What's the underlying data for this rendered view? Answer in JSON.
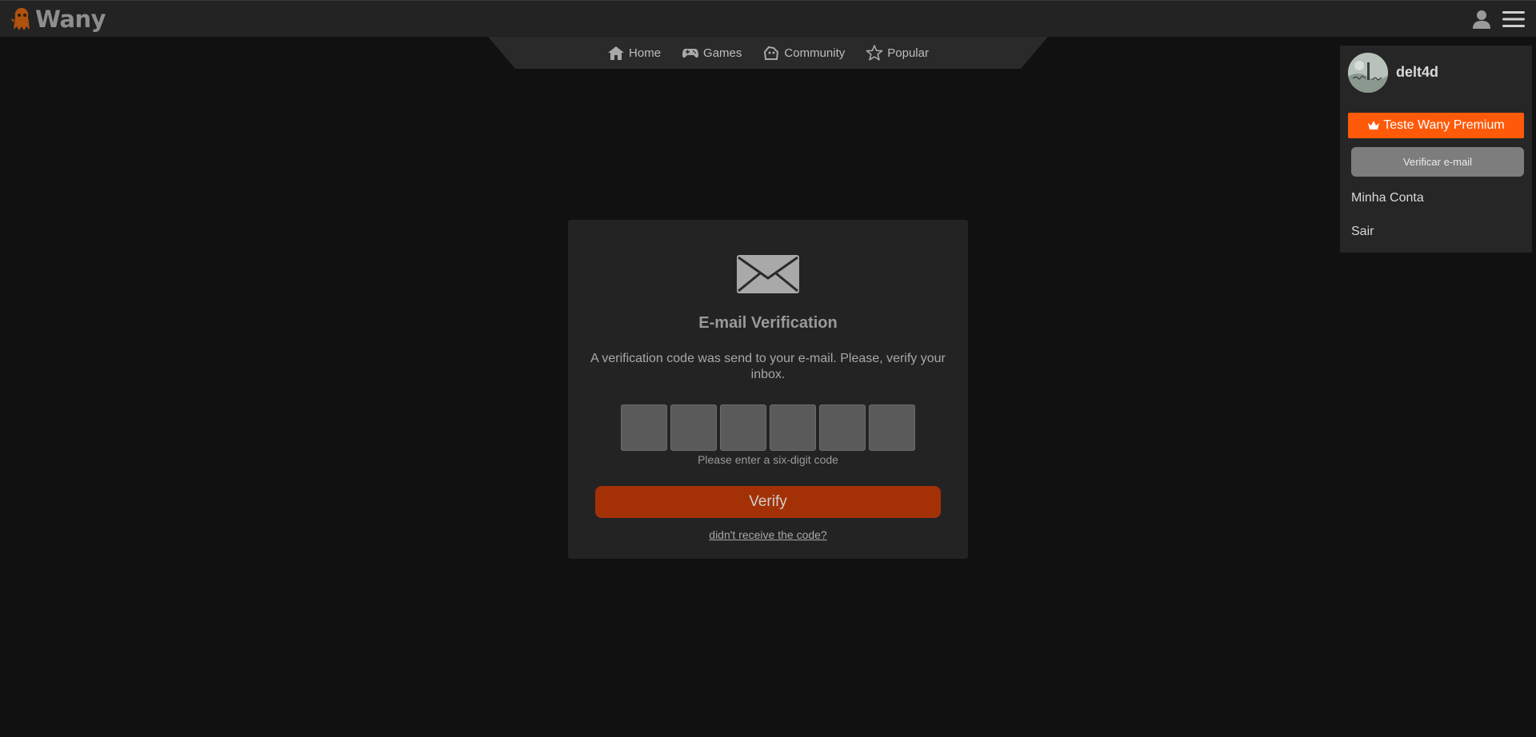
{
  "header": {
    "logo_text": "Wany"
  },
  "nav": {
    "items": [
      {
        "label": "Home",
        "icon": "home-icon"
      },
      {
        "label": "Games",
        "icon": "gamepad-icon"
      },
      {
        "label": "Community",
        "icon": "community-icon"
      },
      {
        "label": "Popular",
        "icon": "star-icon"
      }
    ]
  },
  "verification": {
    "icon": "envelope-icon",
    "title": "E-mail Verification",
    "description": "A verification code was send to your e-mail. Please, verify your inbox.",
    "code_length": 6,
    "hint": "Please enter a six-digit code",
    "verify_label": "Verify",
    "resend_label": "didn't receive the code?"
  },
  "dropdown": {
    "username": "delt4d",
    "premium_label": "Teste Wany Premium",
    "verify_email_label": "Verificar e-mail",
    "links": [
      {
        "label": "Minha Conta"
      },
      {
        "label": "Sair"
      }
    ]
  },
  "colors": {
    "background": "#111111",
    "panel": "#232323",
    "accent": "#ff5a0a",
    "verify_button": "#a43106"
  }
}
